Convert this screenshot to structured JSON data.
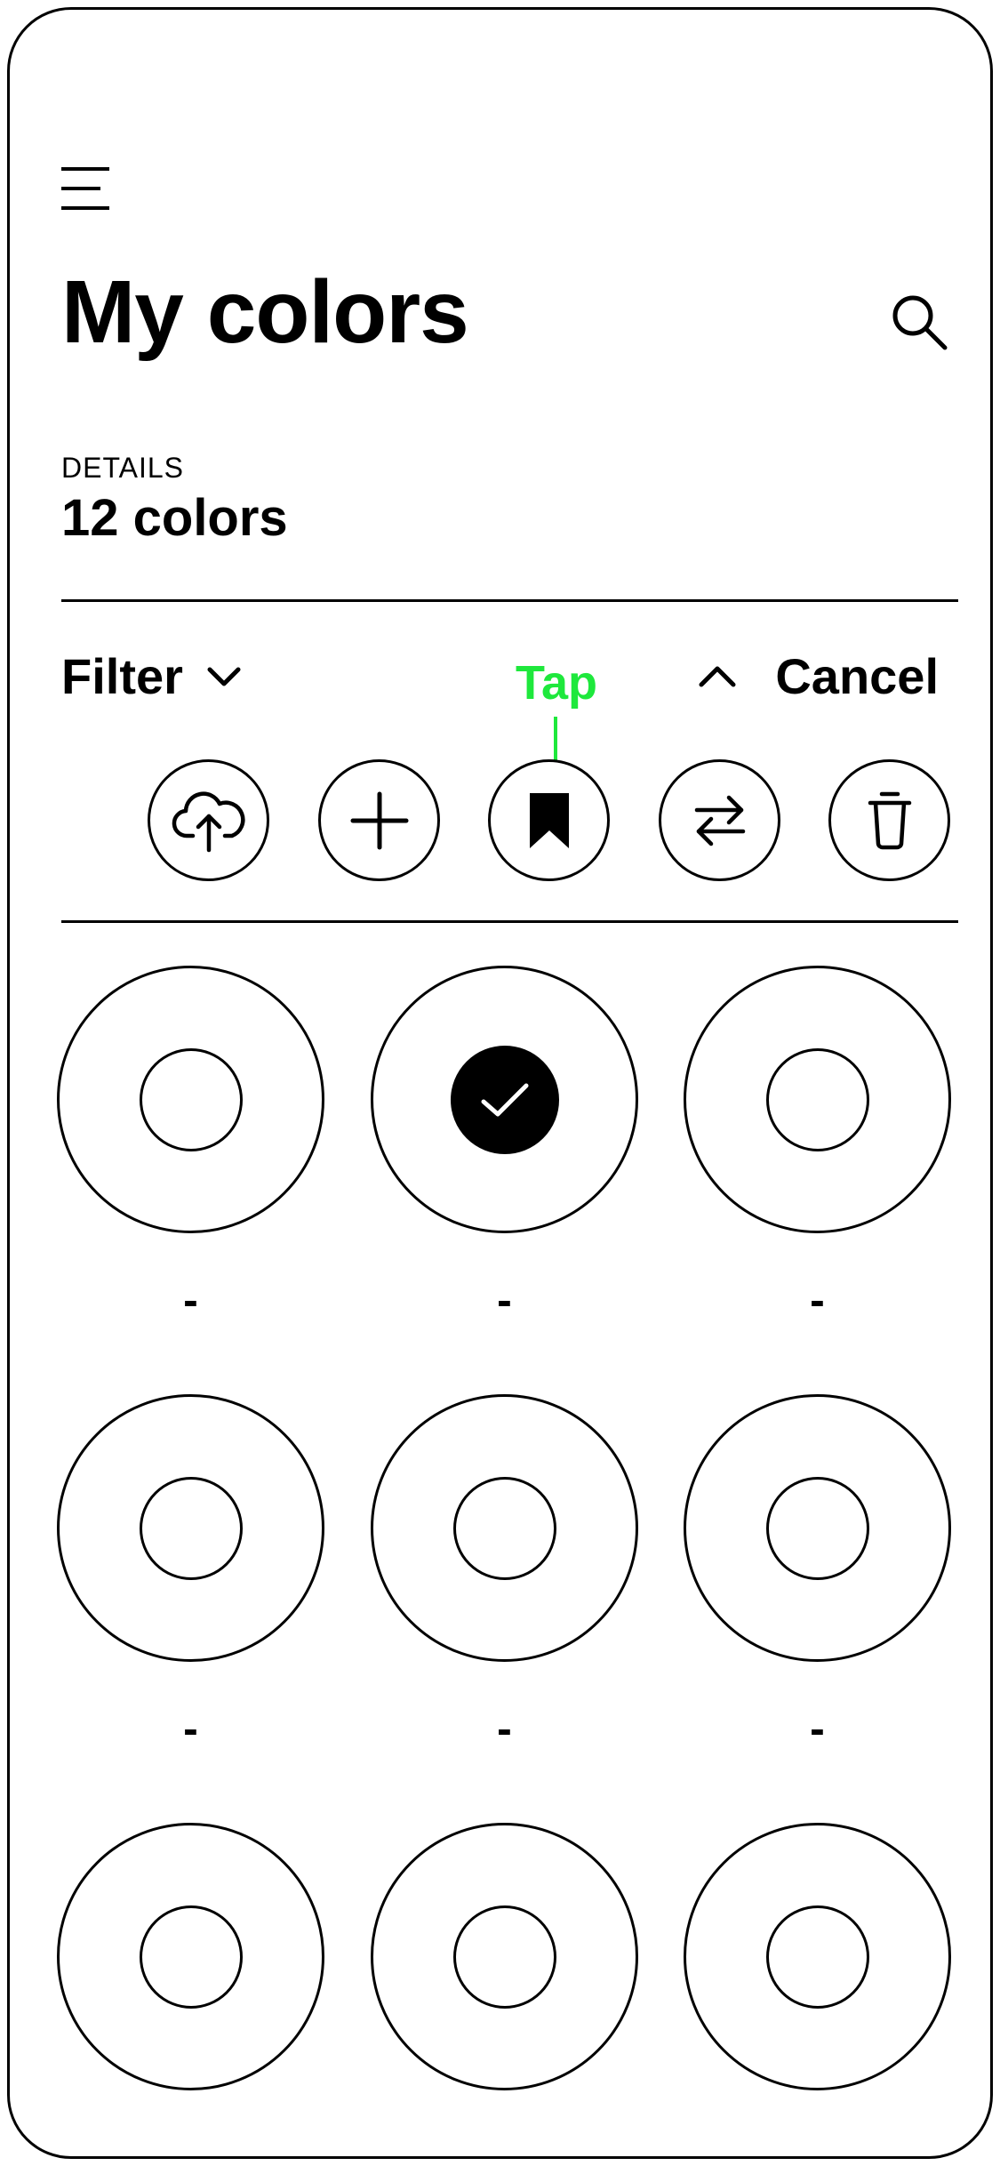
{
  "header": {
    "menu_icon": "hamburger-menu-icon",
    "title": "My colors",
    "search_icon": "search-icon"
  },
  "details": {
    "label": "DETAILS",
    "count": "12 colors"
  },
  "toolbar": {
    "filter_label": "Filter",
    "filter_icon": "chevron-down-icon",
    "collapse_icon": "chevron-up-icon",
    "cancel_label": "Cancel",
    "actions": [
      {
        "name": "upload",
        "icon": "cloud-upload-icon"
      },
      {
        "name": "add",
        "icon": "plus-icon"
      },
      {
        "name": "bookmark",
        "icon": "bookmark-icon"
      },
      {
        "name": "swap",
        "icon": "swap-arrows-icon"
      },
      {
        "name": "delete",
        "icon": "trash-icon"
      }
    ]
  },
  "annotation": {
    "label": "Tap",
    "color": "#1ee83c"
  },
  "swatches": [
    {
      "label": "-",
      "selected": false
    },
    {
      "label": "-",
      "selected": true
    },
    {
      "label": "-",
      "selected": false
    },
    {
      "label": "-",
      "selected": false
    },
    {
      "label": "-",
      "selected": false
    },
    {
      "label": "-",
      "selected": false
    },
    {
      "label": "-",
      "selected": false
    },
    {
      "label": "-",
      "selected": false
    },
    {
      "label": "-",
      "selected": false
    }
  ]
}
